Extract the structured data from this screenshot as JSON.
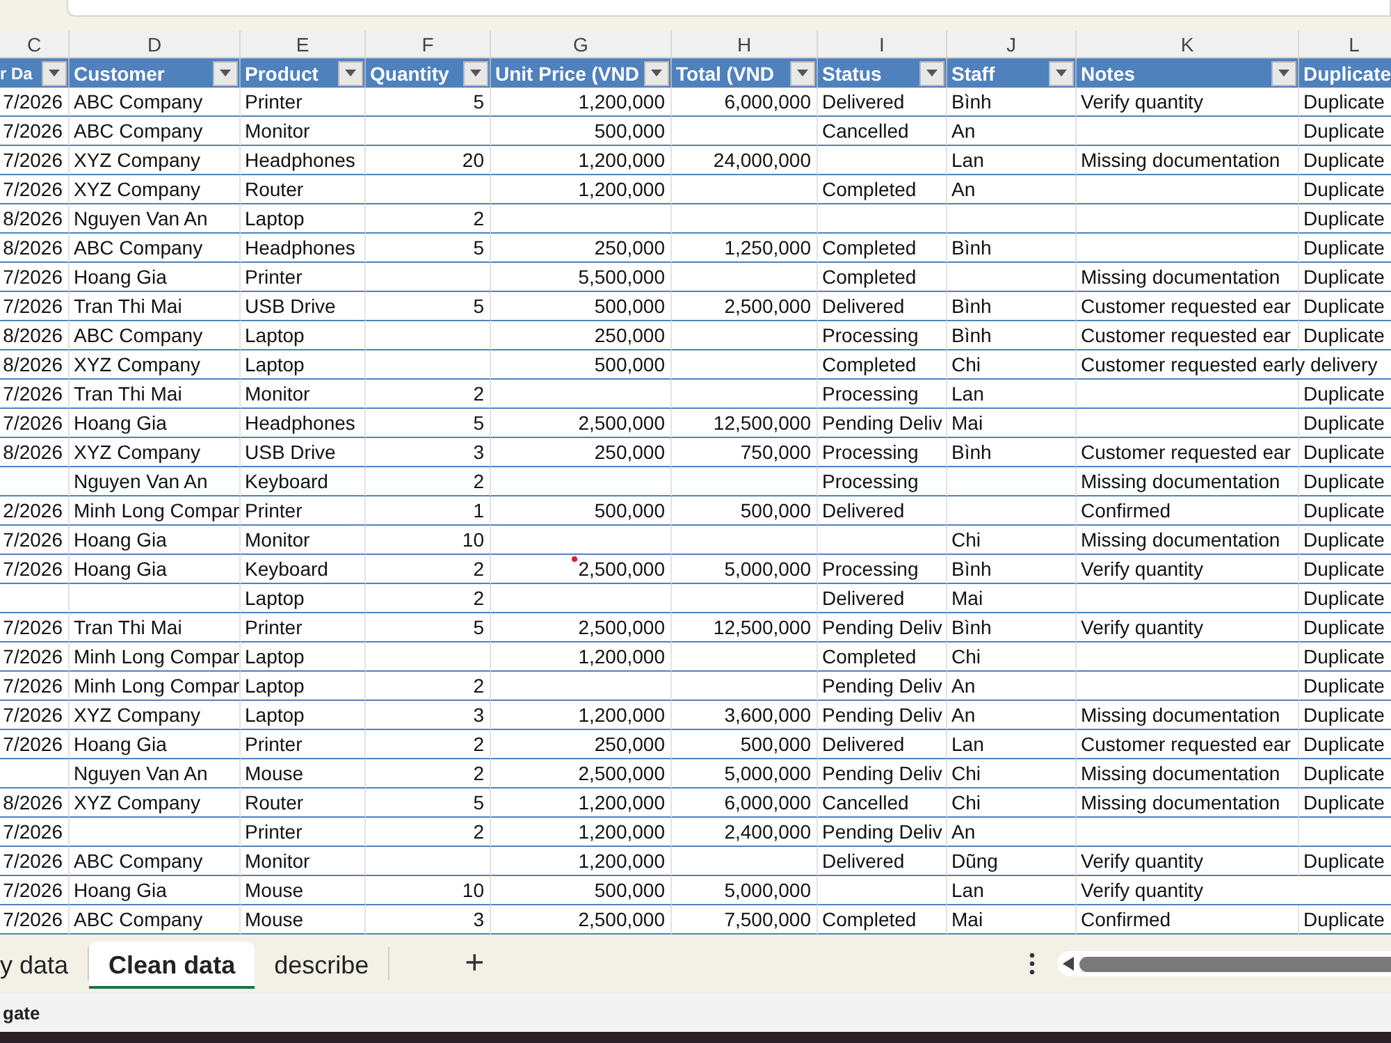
{
  "columns": [
    {
      "letter": "C",
      "header": "r Da",
      "kind": "date"
    },
    {
      "letter": "D",
      "header": "Customer",
      "kind": "text"
    },
    {
      "letter": "E",
      "header": "Product",
      "kind": "text"
    },
    {
      "letter": "F",
      "header": "Quantity",
      "kind": "number"
    },
    {
      "letter": "G",
      "header": "Unit Price (VND",
      "kind": "number"
    },
    {
      "letter": "H",
      "header": "Total (VND",
      "kind": "number"
    },
    {
      "letter": "I",
      "header": "Status",
      "kind": "text"
    },
    {
      "letter": "J",
      "header": "Staff",
      "kind": "text"
    },
    {
      "letter": "K",
      "header": "Notes",
      "kind": "text"
    },
    {
      "letter": "L",
      "header": "Duplicate",
      "kind": "text"
    }
  ],
  "rows": [
    {
      "flagged": false,
      "cells": [
        "7/2026",
        "ABC Company",
        "Printer",
        "5",
        "1,200,000",
        "6,000,000",
        "Delivered",
        "Bình",
        "Verify quantity",
        "Duplicate"
      ]
    },
    {
      "flagged": false,
      "cells": [
        "7/2026",
        "ABC Company",
        "Monitor",
        null,
        "500,000",
        null,
        "Cancelled",
        "An",
        null,
        "Duplicate"
      ]
    },
    {
      "flagged": false,
      "cells": [
        "7/2026",
        "XYZ Company",
        "Headphones",
        "20",
        "1,200,000",
        "24,000,000",
        null,
        "Lan",
        "Missing documentation",
        "Duplicate"
      ]
    },
    {
      "flagged": false,
      "cells": [
        "7/2026",
        "XYZ Company",
        "Router",
        null,
        "1,200,000",
        null,
        "Completed",
        "An",
        null,
        "Duplicate"
      ]
    },
    {
      "flagged": false,
      "cells": [
        "8/2026",
        "Nguyen Van An",
        "Laptop",
        "2",
        null,
        null,
        null,
        null,
        null,
        "Duplicate"
      ]
    },
    {
      "flagged": false,
      "cells": [
        "8/2026",
        "ABC Company",
        "Headphones",
        "5",
        "250,000",
        "1,250,000",
        "Completed",
        "Bình",
        null,
        "Duplicate"
      ]
    },
    {
      "flagged": false,
      "cells": [
        "7/2026",
        "Hoang Gia",
        "Printer",
        null,
        "5,500,000",
        null,
        "Completed",
        null,
        "Missing documentation",
        "Duplicate"
      ]
    },
    {
      "flagged": false,
      "cells": [
        "7/2026",
        "Tran Thi Mai",
        "USB Drive",
        "5",
        "500,000",
        "2,500,000",
        "Delivered",
        "Bình",
        "Customer requested ear",
        "Duplicate"
      ]
    },
    {
      "flagged": false,
      "cells": [
        "8/2026",
        "ABC Company",
        "Laptop",
        null,
        "250,000",
        null,
        "Processing",
        "Bình",
        "Customer requested ear",
        "Duplicate"
      ]
    },
    {
      "flagged": false,
      "cells": [
        "8/2026",
        "XYZ Company",
        "Laptop",
        null,
        "500,000",
        null,
        "Completed",
        "Chi",
        "Customer requested early delivery",
        null
      ]
    },
    {
      "flagged": false,
      "cells": [
        "7/2026",
        "Tran Thi Mai",
        "Monitor",
        "2",
        null,
        null,
        "Processing",
        "Lan",
        null,
        "Duplicate"
      ]
    },
    {
      "flagged": false,
      "cells": [
        "7/2026",
        "Hoang Gia",
        "Headphones",
        "5",
        "2,500,000",
        "12,500,000",
        "Pending Deliv",
        "Mai",
        null,
        "Duplicate"
      ]
    },
    {
      "flagged": false,
      "cells": [
        "8/2026",
        "XYZ Company",
        "USB Drive",
        "3",
        "250,000",
        "750,000",
        "Processing",
        "Bình",
        "Customer requested ear",
        "Duplicate"
      ]
    },
    {
      "flagged": false,
      "cells": [
        null,
        "Nguyen Van An",
        "Keyboard",
        "2",
        null,
        null,
        "Processing",
        null,
        "Missing documentation",
        "Duplicate"
      ]
    },
    {
      "flagged": false,
      "cells": [
        "2/2026",
        "Minh Long Compar",
        "Printer",
        "1",
        "500,000",
        "500,000",
        "Delivered",
        null,
        "Confirmed",
        "Duplicate"
      ]
    },
    {
      "flagged": false,
      "cells": [
        "7/2026",
        "Hoang Gia",
        "Monitor",
        "10",
        null,
        null,
        null,
        "Chi",
        "Missing documentation",
        "Duplicate"
      ]
    },
    {
      "flagged": true,
      "cells": [
        "7/2026",
        "Hoang Gia",
        "Keyboard",
        "2",
        "2,500,000",
        "5,000,000",
        "Processing",
        "Bình",
        "Verify quantity",
        "Duplicate"
      ]
    },
    {
      "flagged": false,
      "cells": [
        null,
        null,
        "Laptop",
        "2",
        null,
        null,
        "Delivered",
        "Mai",
        null,
        "Duplicate"
      ]
    },
    {
      "flagged": false,
      "cells": [
        "7/2026",
        "Tran Thi Mai",
        "Printer",
        "5",
        "2,500,000",
        "12,500,000",
        "Pending Deliv",
        "Bình",
        "Verify quantity",
        "Duplicate"
      ]
    },
    {
      "flagged": false,
      "cells": [
        "7/2026",
        "Minh Long Compar",
        "Laptop",
        null,
        "1,200,000",
        null,
        "Completed",
        "Chi",
        null,
        "Duplicate"
      ]
    },
    {
      "flagged": false,
      "cells": [
        "7/2026",
        "Minh Long Compar",
        "Laptop",
        "2",
        null,
        null,
        "Pending Deliv",
        "An",
        null,
        "Duplicate"
      ]
    },
    {
      "flagged": false,
      "cells": [
        "7/2026",
        "XYZ Company",
        "Laptop",
        "3",
        "1,200,000",
        "3,600,000",
        "Pending Deliv",
        "An",
        "Missing documentation",
        "Duplicate"
      ]
    },
    {
      "flagged": false,
      "cells": [
        "7/2026",
        "Hoang Gia",
        "Printer",
        "2",
        "250,000",
        "500,000",
        "Delivered",
        "Lan",
        "Customer requested ear",
        "Duplicate"
      ]
    },
    {
      "flagged": false,
      "cells": [
        null,
        "Nguyen Van An",
        "Mouse",
        "2",
        "2,500,000",
        "5,000,000",
        "Pending Deliv",
        "Chi",
        "Missing documentation",
        "Duplicate"
      ]
    },
    {
      "flagged": false,
      "cells": [
        "8/2026",
        "XYZ Company",
        "Router",
        "5",
        "1,200,000",
        "6,000,000",
        "Cancelled",
        "Chi",
        "Missing documentation",
        "Duplicate"
      ]
    },
    {
      "flagged": false,
      "cells": [
        "7/2026",
        null,
        "Printer",
        "2",
        "1,200,000",
        "2,400,000",
        "Pending Deliv",
        "An",
        null,
        null
      ]
    },
    {
      "flagged": false,
      "cells": [
        "7/2026",
        "ABC Company",
        "Monitor",
        null,
        "1,200,000",
        null,
        "Delivered",
        "Dũng",
        "Verify quantity",
        "Duplicate"
      ]
    },
    {
      "flagged": false,
      "cells": [
        "7/2026",
        "Hoang Gia",
        "Mouse",
        "10",
        "500,000",
        "5,000,000",
        null,
        "Lan",
        "Verify quantity",
        null
      ]
    },
    {
      "flagged": false,
      "cells": [
        "7/2026",
        "ABC Company",
        "Mouse",
        "3",
        "2,500,000",
        "7,500,000",
        "Completed",
        "Mai",
        "Confirmed",
        "Duplicate"
      ]
    }
  ],
  "sheet_tabs": [
    {
      "label": "y data",
      "selected": false
    },
    {
      "label": "Clean data",
      "selected": true
    },
    {
      "label": "describe",
      "selected": false
    }
  ],
  "add_sheet": "+",
  "status_bar": {
    "text": "gate"
  }
}
